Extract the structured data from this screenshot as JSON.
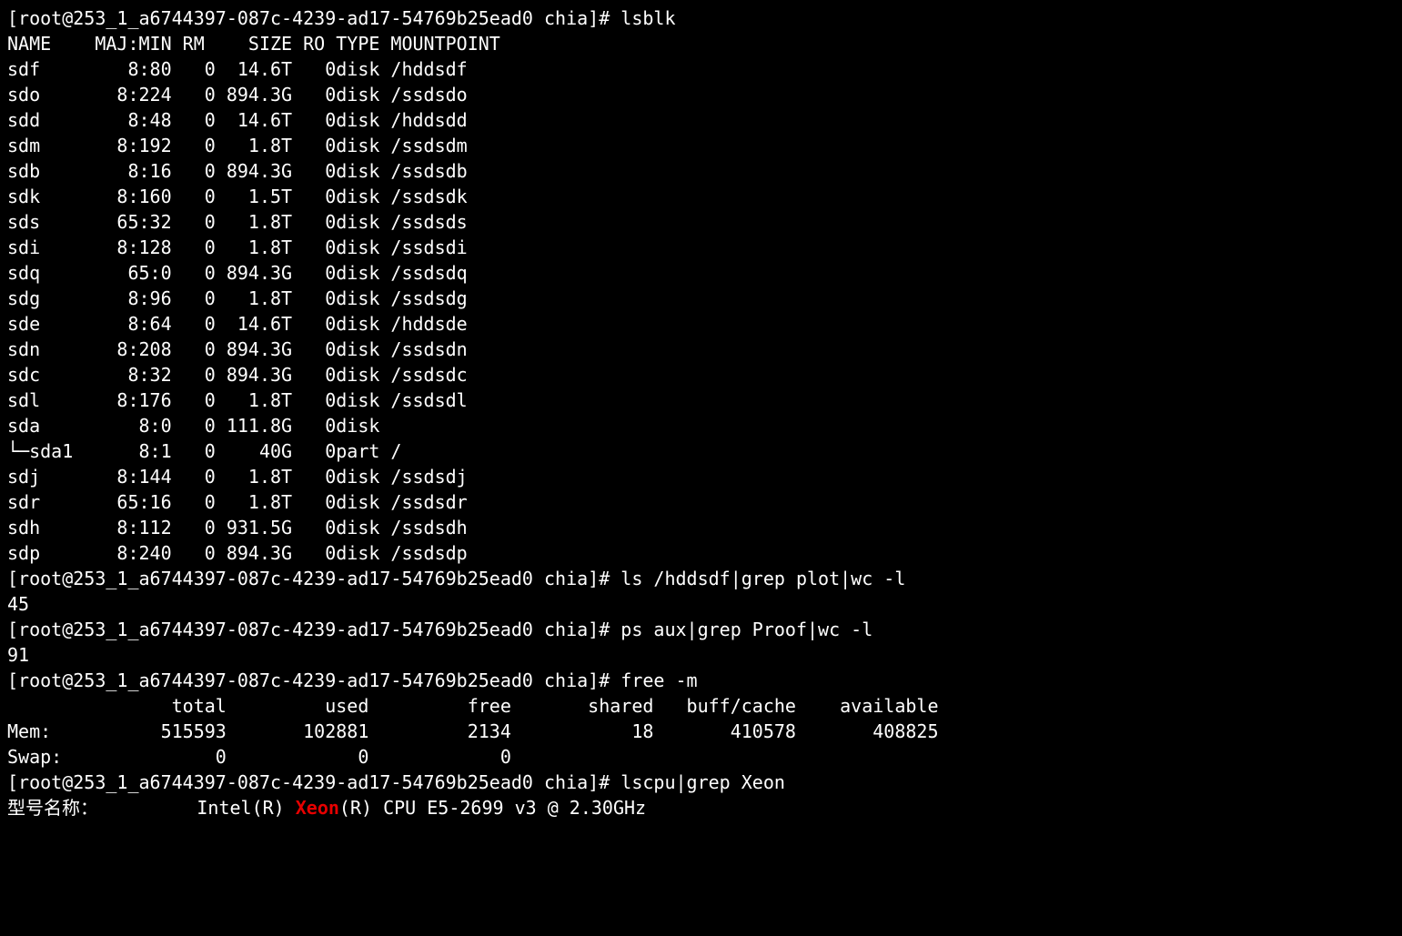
{
  "prompt_prefix": "[root@253_1_a6744397-087c-4239-ad17-54769b25ead0 chia]# ",
  "commands": {
    "lsblk": "lsblk",
    "ls_plot": "ls /hddsdf|grep plot|wc -l",
    "ps_proof": "ps aux|grep Proof|wc -l",
    "free": "free -m",
    "lscpu": "lscpu|grep Xeon"
  },
  "lsblk": {
    "header": [
      "NAME",
      "MAJ:MIN",
      "RM",
      "SIZE",
      "RO",
      "TYPE",
      "MOUNTPOINT"
    ],
    "rows": [
      {
        "name": "sdf",
        "majmin": "8:80",
        "rm": "0",
        "size": "14.6T",
        "ro": "0",
        "type": "disk",
        "mount": "/hddsdf"
      },
      {
        "name": "sdo",
        "majmin": "8:224",
        "rm": "0",
        "size": "894.3G",
        "ro": "0",
        "type": "disk",
        "mount": "/ssdsdo"
      },
      {
        "name": "sdd",
        "majmin": "8:48",
        "rm": "0",
        "size": "14.6T",
        "ro": "0",
        "type": "disk",
        "mount": "/hddsdd"
      },
      {
        "name": "sdm",
        "majmin": "8:192",
        "rm": "0",
        "size": "1.8T",
        "ro": "0",
        "type": "disk",
        "mount": "/ssdsdm"
      },
      {
        "name": "sdb",
        "majmin": "8:16",
        "rm": "0",
        "size": "894.3G",
        "ro": "0",
        "type": "disk",
        "mount": "/ssdsdb"
      },
      {
        "name": "sdk",
        "majmin": "8:160",
        "rm": "0",
        "size": "1.5T",
        "ro": "0",
        "type": "disk",
        "mount": "/ssdsdk"
      },
      {
        "name": "sds",
        "majmin": "65:32",
        "rm": "0",
        "size": "1.8T",
        "ro": "0",
        "type": "disk",
        "mount": "/ssdsds"
      },
      {
        "name": "sdi",
        "majmin": "8:128",
        "rm": "0",
        "size": "1.8T",
        "ro": "0",
        "type": "disk",
        "mount": "/ssdsdi"
      },
      {
        "name": "sdq",
        "majmin": "65:0",
        "rm": "0",
        "size": "894.3G",
        "ro": "0",
        "type": "disk",
        "mount": "/ssdsdq"
      },
      {
        "name": "sdg",
        "majmin": "8:96",
        "rm": "0",
        "size": "1.8T",
        "ro": "0",
        "type": "disk",
        "mount": "/ssdsdg"
      },
      {
        "name": "sde",
        "majmin": "8:64",
        "rm": "0",
        "size": "14.6T",
        "ro": "0",
        "type": "disk",
        "mount": "/hddsde"
      },
      {
        "name": "sdn",
        "majmin": "8:208",
        "rm": "0",
        "size": "894.3G",
        "ro": "0",
        "type": "disk",
        "mount": "/ssdsdn"
      },
      {
        "name": "sdc",
        "majmin": "8:32",
        "rm": "0",
        "size": "894.3G",
        "ro": "0",
        "type": "disk",
        "mount": "/ssdsdc"
      },
      {
        "name": "sdl",
        "majmin": "8:176",
        "rm": "0",
        "size": "1.8T",
        "ro": "0",
        "type": "disk",
        "mount": "/ssdsdl"
      },
      {
        "name": "sda",
        "majmin": "8:0",
        "rm": "0",
        "size": "111.8G",
        "ro": "0",
        "type": "disk",
        "mount": ""
      },
      {
        "name": "└─sda1",
        "majmin": "8:1",
        "rm": "0",
        "size": "40G",
        "ro": "0",
        "type": "part",
        "mount": "/"
      },
      {
        "name": "sdj",
        "majmin": "8:144",
        "rm": "0",
        "size": "1.8T",
        "ro": "0",
        "type": "disk",
        "mount": "/ssdsdj"
      },
      {
        "name": "sdr",
        "majmin": "65:16",
        "rm": "0",
        "size": "1.8T",
        "ro": "0",
        "type": "disk",
        "mount": "/ssdsdr"
      },
      {
        "name": "sdh",
        "majmin": "8:112",
        "rm": "0",
        "size": "931.5G",
        "ro": "0",
        "type": "disk",
        "mount": "/ssdsdh"
      },
      {
        "name": "sdp",
        "majmin": "8:240",
        "rm": "0",
        "size": "894.3G",
        "ro": "0",
        "type": "disk",
        "mount": "/ssdsdp"
      }
    ]
  },
  "ls_plot_result": "45",
  "ps_proof_result": "91",
  "free_m": {
    "header": [
      "",
      "total",
      "used",
      "free",
      "shared",
      "buff/cache",
      "available"
    ],
    "rows": [
      {
        "label": "Mem:",
        "total": "515593",
        "used": "102881",
        "free": "2134",
        "shared": "18",
        "buffcache": "410578",
        "available": "408825"
      },
      {
        "label": "Swap:",
        "total": "0",
        "used": "0",
        "free": "0",
        "shared": "",
        "buffcache": "",
        "available": ""
      }
    ]
  },
  "lscpu_out": {
    "label": "型号名称：",
    "pre": "Intel(R) ",
    "hl": "Xeon",
    "post": "(R) CPU E5-2699 v3 @ 2.30GHz"
  }
}
